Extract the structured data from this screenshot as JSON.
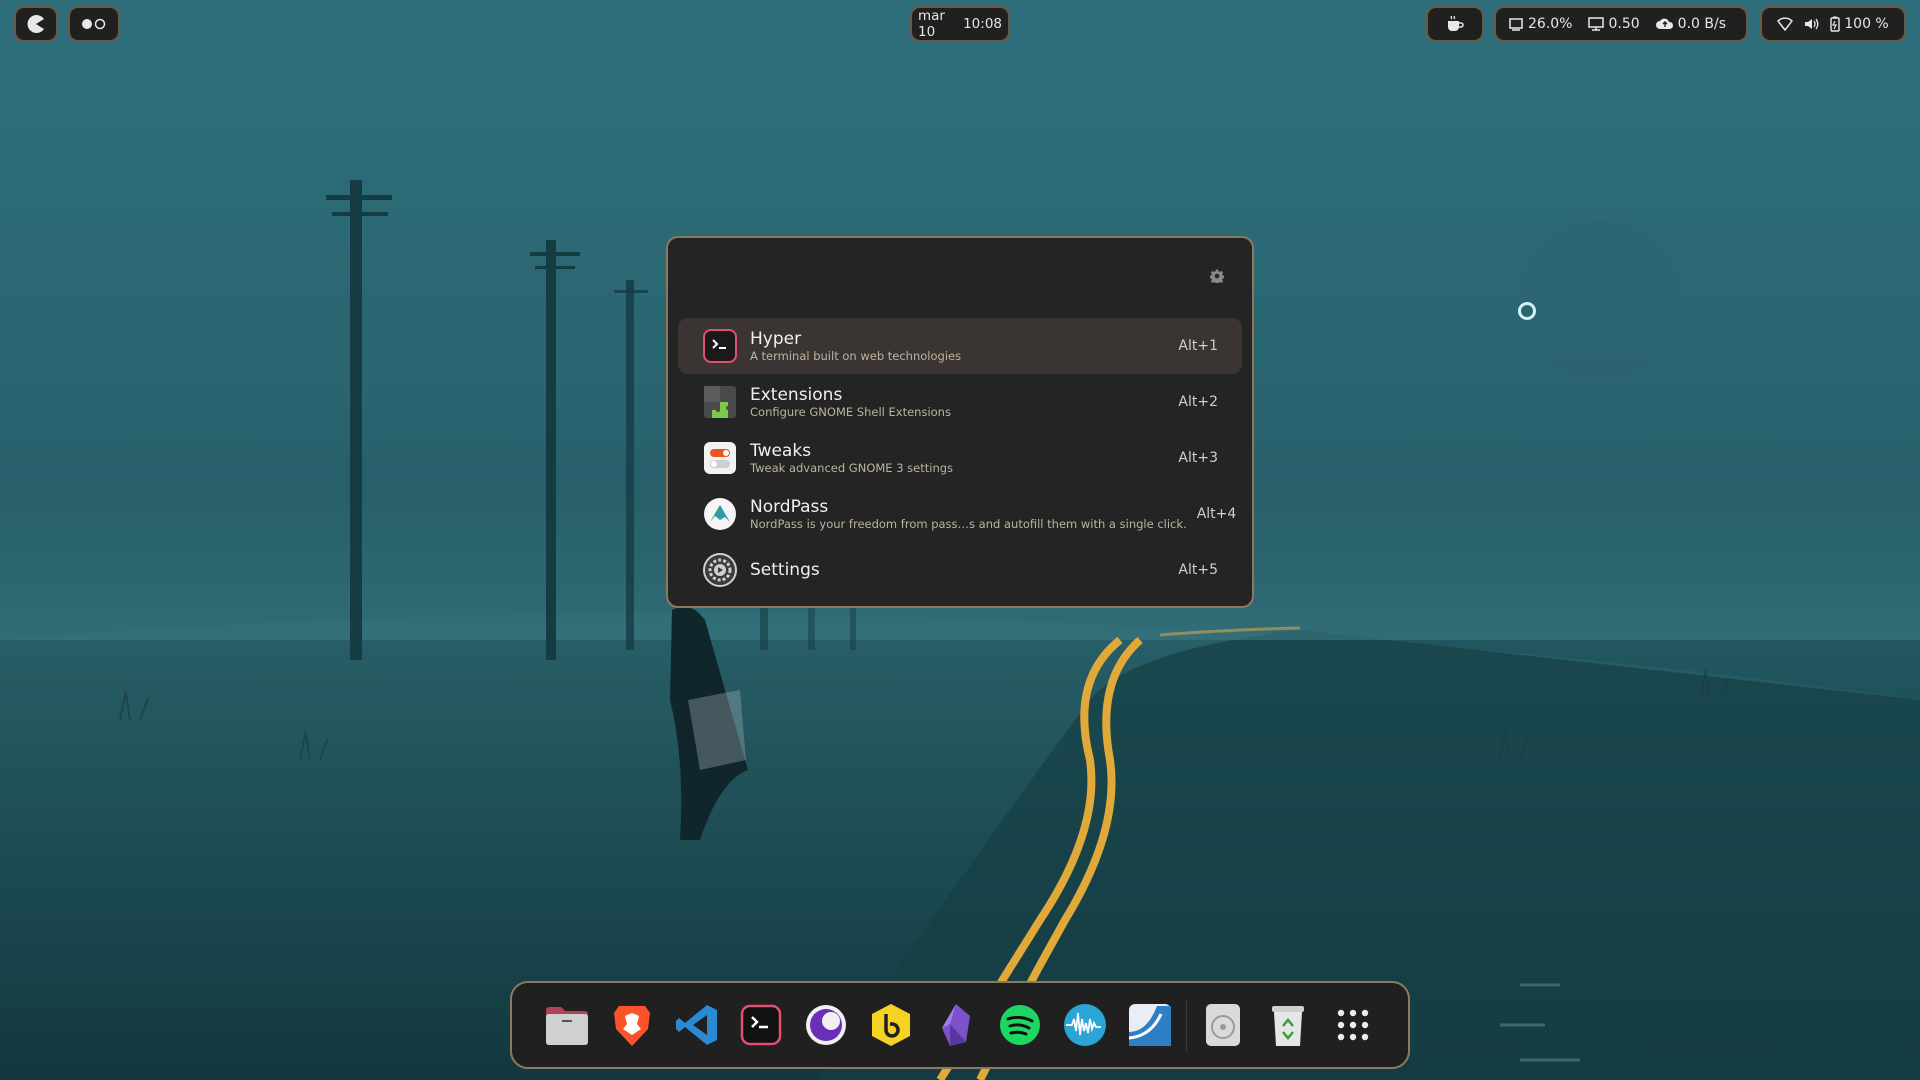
{
  "topbar": {
    "activities_icon": "pacman-icon",
    "workspace_icon": "workspace-dots-icon",
    "date": "mar 10",
    "time": "10:08",
    "coffee_icon": "coffee-icon",
    "cpu": "26.0%",
    "load": "0.50",
    "net": "0.0 B/s",
    "battery": "100 %",
    "status_icons": [
      "wifi-icon",
      "volume-icon",
      "battery-icon"
    ]
  },
  "launcher": {
    "settings_icon": "gear-icon",
    "items": [
      {
        "title": "Hyper",
        "desc": "A terminal built on web technologies",
        "shortcut": "Alt+1",
        "icon": "hyper-icon"
      },
      {
        "title": "Extensions",
        "desc": "Configure GNOME Shell Extensions",
        "shortcut": "Alt+2",
        "icon": "extensions-icon"
      },
      {
        "title": "Tweaks",
        "desc": "Tweak advanced GNOME 3 settings",
        "shortcut": "Alt+3",
        "icon": "tweaks-icon"
      },
      {
        "title": "NordPass",
        "desc": "NordPass is your freedom from pass…s and autofill them with a single click.",
        "shortcut": "Alt+4",
        "icon": "nordpass-icon"
      },
      {
        "title": "Settings",
        "desc": "",
        "shortcut": "Alt+5",
        "icon": "settings-icon"
      }
    ]
  },
  "dock": {
    "apps": [
      "files-icon",
      "brave-icon",
      "vscode-icon",
      "hyper-icon",
      "tor-browser-icon",
      "beeper-icon",
      "obsidian-icon",
      "spotify-icon",
      "audio-recorder-icon",
      "kdenlive-icon",
      "disk-icon",
      "trash-icon",
      "app-grid-icon"
    ]
  },
  "colors": {
    "accent_border": "#8c7a60",
    "panel_bg": "#242424",
    "selected_bg": "#3a3533",
    "wallpaper": "#2a6571"
  }
}
